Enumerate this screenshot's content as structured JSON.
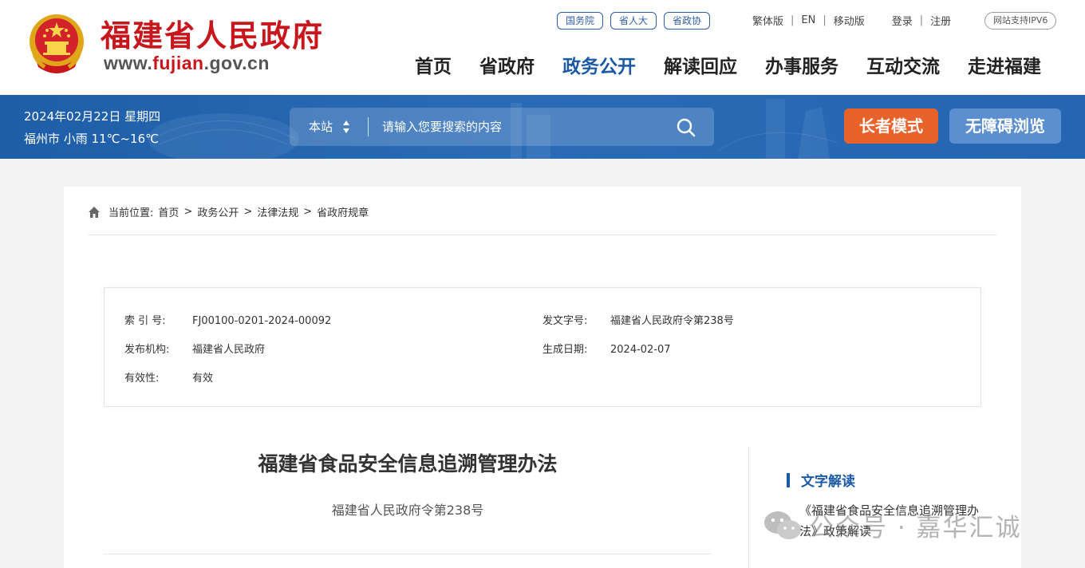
{
  "header": {
    "site_name": "福建省人民政府",
    "url_prefix": "www.",
    "url_brand": "fujian",
    "url_suffix": ".gov.cn",
    "pills": [
      "国务院",
      "省人大",
      "省政协"
    ],
    "lang_links": [
      "繁体版",
      "EN",
      "移动版"
    ],
    "account_links": [
      "登录",
      "注册"
    ],
    "ipv6_badge": "网站支持IPV6",
    "nav": [
      "首页",
      "省政府",
      "政务公开",
      "解读回应",
      "办事服务",
      "互动交流",
      "走进福建"
    ],
    "active_nav": "政务公开"
  },
  "banner": {
    "date": "2024年02月22日 星期四",
    "weather": "福州市 小雨 11℃~16℃",
    "search_scope": "本站",
    "search_placeholder": "请输入您要搜索的内容",
    "elder_mode": "长者模式",
    "accessible": "无障碍浏览"
  },
  "breadcrumb": {
    "label": "当前位置:",
    "items": [
      "首页",
      "政务公开",
      "法律法规",
      "省政府规章"
    ]
  },
  "meta": {
    "index_no_label": "索 引 号:",
    "index_no": "FJ00100-0201-2024-00092",
    "doc_no_label": "发文字号:",
    "doc_no": "福建省人民政府令第238号",
    "issuer_label": "发布机构:",
    "issuer": "福建省人民政府",
    "date_label": "生成日期:",
    "date": "2024-02-07",
    "validity_label": "有效性:",
    "validity": "有效"
  },
  "document": {
    "title": "福建省食品安全信息追溯管理办法",
    "subtitle": "福建省人民政府令第238号"
  },
  "sidebar": {
    "heading": "文字解读",
    "link": "《福建省食品安全信息追溯管理办法》政策解读"
  },
  "watermark": {
    "text": "公众号 · 嘉华汇诚"
  },
  "colors": {
    "brand_red": "#c8161d",
    "nav_blue": "#1c5aa6",
    "banner_blue": "#2566b2",
    "elder_orange": "#e8622c",
    "accessible_blue": "#5b8fd0"
  }
}
